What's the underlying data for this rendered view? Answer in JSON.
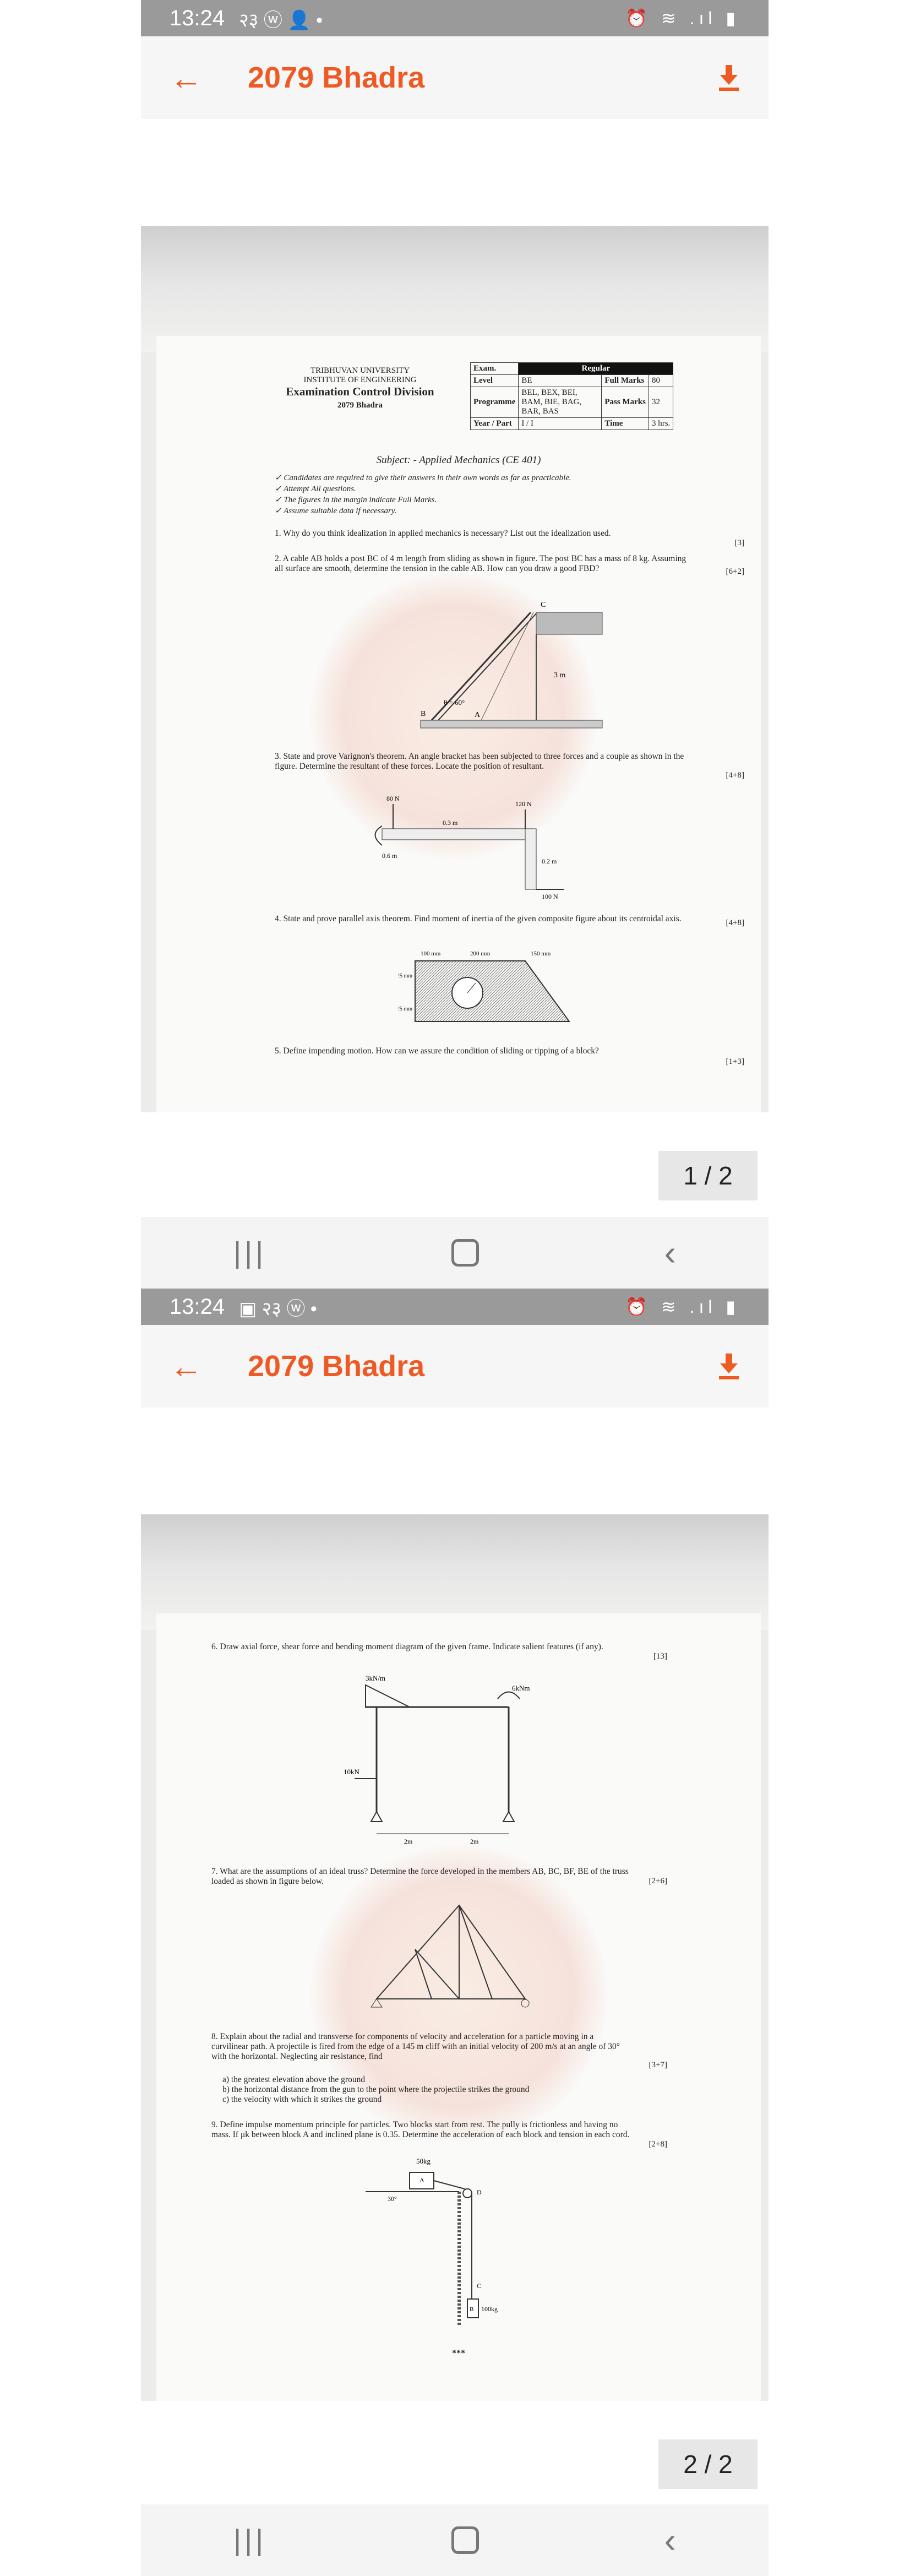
{
  "status_bar_1": {
    "time": "13:24",
    "left_icons": "२३ ⓦ 👤 •"
  },
  "status_bar_2": {
    "time": "13:24",
    "left_icons": "▣ २३ ⓦ •"
  },
  "app_bar": {
    "title": "2079 Bhadra",
    "back_icon": "arrow-left",
    "download_icon": "download"
  },
  "page1": {
    "header": {
      "university": "TRIBHUVAN UNIVERSITY",
      "institute": "INSTITUTE OF ENGINEERING",
      "division": "Examination Control Division",
      "session": "2079 Bhadra"
    },
    "meta": {
      "exam_label": "Exam.",
      "exam_value": "Regular",
      "level_label": "Level",
      "level_value": "BE",
      "full_marks_label": "Full Marks",
      "full_marks_value": "80",
      "programme_label": "Programme",
      "programme_value": "BEL, BEX, BEI, BAM, BIE, BAG, BAR, BAS",
      "pass_marks_label": "Pass Marks",
      "pass_marks_value": "32",
      "year_label": "Year / Part",
      "year_value": "I / I",
      "time_label": "Time",
      "time_value": "3 hrs."
    },
    "subject": "Subject: - Applied Mechanics (CE 401)",
    "instructions": [
      "Candidates are required to give their answers in their own words as far as practicable.",
      "Attempt All questions.",
      "The figures in the margin indicate Full Marks.",
      "Assume suitable data if necessary."
    ],
    "questions": [
      {
        "text": "1.  Why do you think idealization in applied mechanics is necessary? List out the idealization used.",
        "marks": "[3]"
      },
      {
        "text": "2.  A cable AB holds a post BC of 4 m length from sliding as shown in figure. The post BC has a mass of 8 kg. Assuming all surface are smooth, determine the tension in the cable AB. How can you draw a good FBD?",
        "marks": "[6+2]"
      },
      {
        "text": "3.  State and prove Varignon's theorem. An angle bracket has been subjected to three forces and a couple as shown in the figure. Determine the resultant of these forces. Locate the position of resultant.",
        "marks": "[4+8]"
      },
      {
        "text": "4.  State and prove parallel axis theorem. Find moment of inertia of the given composite figure about its centroidal axis.",
        "marks": "[4+8]"
      },
      {
        "text": "5.  Define impending motion. How can we assure the condition of sliding or tipping of a block?",
        "marks": "[1+3]"
      }
    ],
    "fig_q2": {
      "label_c": "C",
      "label_b": "B",
      "label_a": "A",
      "angle": "θ = 60°",
      "height": "3 m"
    },
    "fig_q3": {
      "f1": "80 N",
      "d1": "0.3 m",
      "f2": "120 N",
      "d2": "0.6 m",
      "d3": "0.2 m",
      "f3": "100 N"
    },
    "fig_q4": {
      "w1": "100 mm",
      "w2": "200 mm",
      "w3": "150 mm",
      "h1": "125 mm",
      "h2": "125 mm"
    },
    "pager": "1 / 2"
  },
  "page2": {
    "questions": [
      {
        "text": "6.  Draw axial force, shear force and bending moment diagram of the given frame. Indicate salient features (if any).",
        "marks": "[13]"
      },
      {
        "text": "7.  What are the assumptions of an ideal truss? Determine the force developed in the members AB, BC, BF, BE of the truss loaded as shown in figure below.",
        "marks": "[2+6]"
      },
      {
        "text": "8.  Explain about the radial and transverse for components of velocity and acceleration for a particle moving in a curvilinear path. A projectile is fired from the edge of a 145 m cliff with an initial velocity of 200 m/s at an angle of 30° with the horizontal. Neglecting air resistance, find",
        "marks": "[3+7]"
      },
      {
        "text": "9.  Define impulse momentum principle for particles. Two blocks start from rest. The pully is frictionless and having no mass. If μk between block A and inclined plane is 0.35. Determine the acceleration of each block and tension in each cord.",
        "marks": "[2+8]"
      }
    ],
    "q8_parts": [
      "a)  the greatest elevation above the ground",
      "b)  the horizontal distance from the gun to the point where the projectile strikes the ground",
      "c)  the velocity with which it strikes the ground"
    ],
    "fig_q6": {
      "udl": "3kN/m",
      "moment": "6kNm",
      "load": "10kN",
      "span1": "2m",
      "span2": "2m"
    },
    "fig_q9": {
      "mass_a": "50kg",
      "mass_b": "100kg",
      "angle": "30°",
      "label_a": "A",
      "label_b": "B",
      "label_c": "C",
      "label_d": "D"
    },
    "end_mark": "***",
    "pager": "2 / 2"
  },
  "nav": {
    "recents": "recents",
    "home": "home",
    "back": "back"
  }
}
